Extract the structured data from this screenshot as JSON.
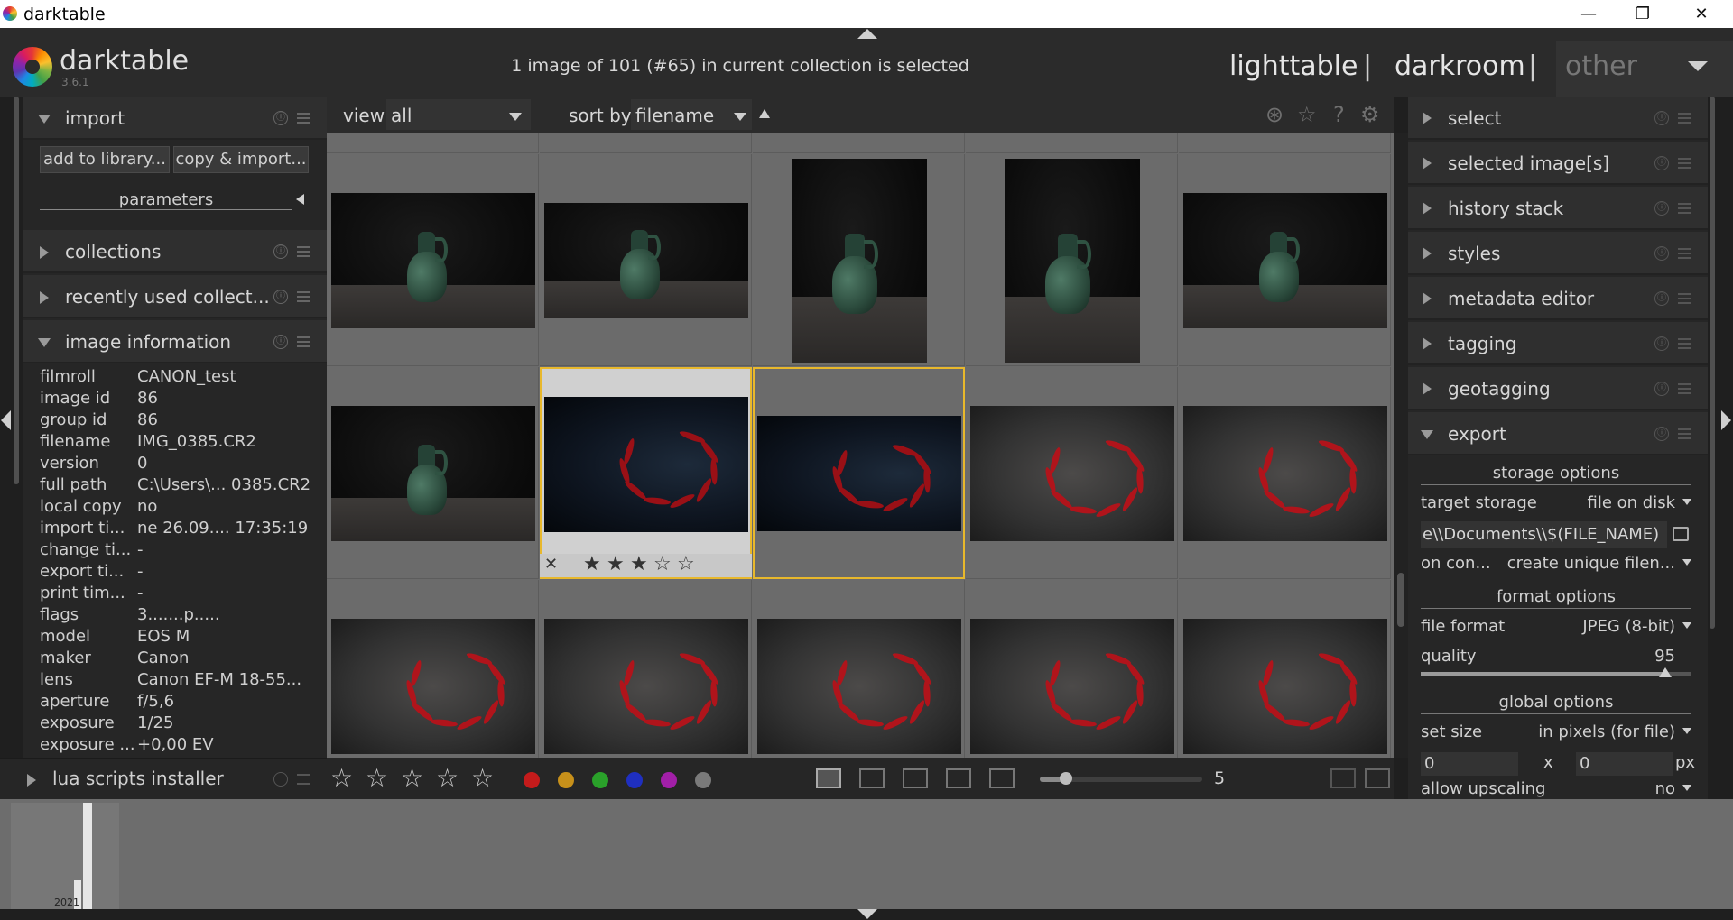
{
  "window": {
    "title": "darktable",
    "minimize": "—",
    "maximize": "❐",
    "close": "✕"
  },
  "header": {
    "logo_text": "darktable",
    "version": "3.6.1",
    "selection_info": "1 image of 101 (#65) in current collection is selected",
    "views": {
      "lighttable": "lighttable",
      "separator": "|",
      "darkroom": "darkroom",
      "other": "other"
    }
  },
  "left_panel": {
    "import": {
      "label": "import",
      "add_to_library": "add to library...",
      "copy_import": "copy & import...",
      "parameters": "parameters"
    },
    "collections": "collections",
    "recently_used": "recently used collect...",
    "image_information": {
      "label": "image information",
      "rows": [
        {
          "k": "filmroll",
          "v": "CANON_test"
        },
        {
          "k": "image id",
          "v": "86"
        },
        {
          "k": "group id",
          "v": "86"
        },
        {
          "k": "filename",
          "v": "IMG_0385.CR2"
        },
        {
          "k": "version",
          "v": "0"
        },
        {
          "k": "full path",
          "v": "C:\\Users\\... 0385.CR2"
        },
        {
          "k": "local copy",
          "v": "no"
        },
        {
          "k": "import ti...",
          "v": "ne 26.09.... 17:35:19"
        },
        {
          "k": "change ti...",
          "v": "-"
        },
        {
          "k": "export ti...",
          "v": "-"
        },
        {
          "k": "print tim...",
          "v": "-"
        },
        {
          "k": "flags",
          "v": "3.......p....."
        },
        {
          "k": "model",
          "v": "EOS M"
        },
        {
          "k": "maker",
          "v": "Canon"
        },
        {
          "k": "lens",
          "v": "Canon EF-M 18-55..."
        },
        {
          "k": "aperture",
          "v": "f/5,6"
        },
        {
          "k": "exposure",
          "v": "1/25"
        },
        {
          "k": "exposure ...",
          "v": "+0,00 EV"
        }
      ]
    },
    "lua_scripts_installer": "lua scripts installer",
    "info_icon": "ⓘ"
  },
  "toolbar": {
    "view_label": "view",
    "view_value": "all",
    "sort_label": "sort by",
    "sort_value": "filename",
    "icons": [
      "color-labels-icon",
      "star-icon",
      "help-icon",
      "settings-icon"
    ]
  },
  "grid": {
    "columns": 5,
    "thumbs": [
      {
        "kind": "jug",
        "orient": "landscape"
      },
      {
        "kind": "jug",
        "orient": "landscape"
      },
      {
        "kind": "jug",
        "orient": "portrait"
      },
      {
        "kind": "jug",
        "orient": "portrait"
      },
      {
        "kind": "jug",
        "orient": "landscape"
      },
      {
        "kind": "jug",
        "orient": "landscape"
      },
      {
        "kind": "chili-dark",
        "orient": "landscape",
        "state": "hover",
        "stars": 3
      },
      {
        "kind": "chili-dark",
        "orient": "landscape",
        "state": "selected"
      },
      {
        "kind": "chili",
        "orient": "landscape"
      },
      {
        "kind": "chili",
        "orient": "landscape"
      },
      {
        "kind": "chili",
        "orient": "landscape"
      },
      {
        "kind": "chili",
        "orient": "landscape"
      },
      {
        "kind": "chili",
        "orient": "landscape"
      },
      {
        "kind": "chili",
        "orient": "landscape"
      },
      {
        "kind": "chili",
        "orient": "landscape"
      }
    ],
    "reject_symbol": "✕"
  },
  "bottom_bar": {
    "color_labels": [
      "#c41b1b",
      "#c7901a",
      "#2aa12a",
      "#1f2fc0",
      "#a21fa8",
      "#7a7a7a"
    ],
    "zoom_value": "5"
  },
  "right_panel": {
    "modules": [
      "select",
      "selected image[s]",
      "history stack",
      "styles",
      "metadata editor",
      "tagging",
      "geotagging"
    ],
    "export": {
      "label": "export",
      "storage_options": "storage options",
      "target_storage_label": "target storage",
      "target_storage_value": "file on disk",
      "path": "e\\\\Documents\\\\$(FILE_NAME)",
      "on_conflict_label": "on con...",
      "on_conflict_value": "create unique filen...",
      "format_options": "format options",
      "file_format_label": "file format",
      "file_format_value": "JPEG (8-bit)",
      "quality_label": "quality",
      "quality_value": "95",
      "global_options": "global options",
      "set_size_label": "set size",
      "set_size_value": "in pixels (for file)",
      "width": "0",
      "x": "x",
      "height": "0",
      "px": "px",
      "upscaling_label": "allow upscaling",
      "upscaling_value": "no"
    }
  },
  "filmstrip": {
    "year": "2021"
  }
}
